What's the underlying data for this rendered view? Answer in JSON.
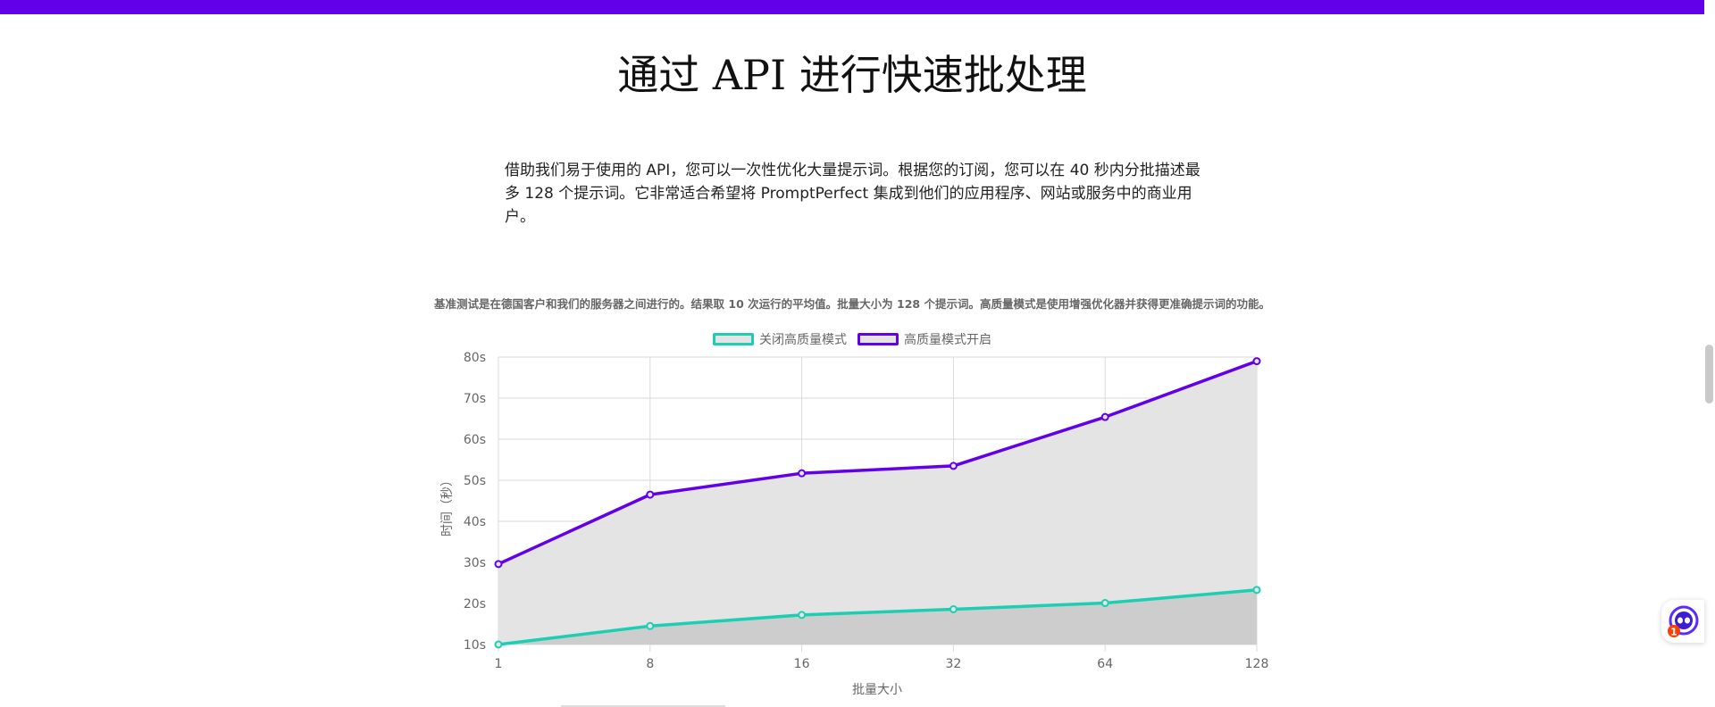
{
  "page": {
    "title": "通过 API 进行快速批处理",
    "intro": "借助我们易于使用的 API，您可以一次性优化大量提示词。根据您的订阅，您可以在 40 秒内分批描述最多 128 个提示词。它非常适合希望将 PromptPerfect 集成到他们的应用程序、网站或服务中的商业用户。",
    "caption": "基准测试是在德国客户和我们的服务器之间进行的。结果取 10 次运行的平均值。批量大小为 128 个提示词。高质量模式是使用增强优化器并获得更准确提示词的功能。"
  },
  "colors": {
    "accent": "#6200ea",
    "teal": "#1ccfb3",
    "purple": "#6200ea",
    "fill_upper": "#e4e4e4",
    "fill_lower": "#cdcdcd",
    "grid": "#dadada",
    "tick_text": "#666666"
  },
  "chat_widget": {
    "icon": "chat-robot-icon",
    "badge": "1",
    "badge_color": "#ff3d00"
  },
  "chart_data": {
    "type": "line",
    "title": "",
    "xlabel": "批量大小",
    "ylabel": "时间（秒）",
    "categories": [
      "1",
      "8",
      "16",
      "32",
      "64",
      "128"
    ],
    "ylim": [
      10,
      80
    ],
    "yticks": [
      "10s",
      "20s",
      "30s",
      "40s",
      "50s",
      "60s",
      "70s",
      "80s"
    ],
    "ytick_values": [
      10,
      20,
      30,
      40,
      50,
      60,
      70,
      80
    ],
    "grid": true,
    "legend_position": "top",
    "series": [
      {
        "name": "关闭高质量模式",
        "values": [
          10,
          14.5,
          17.2,
          18.6,
          20.1,
          23.3
        ],
        "color": "#1ccfb3"
      },
      {
        "name": "高质量模式开启",
        "values": [
          29.6,
          46.5,
          51.7,
          53.5,
          65.4,
          79
        ],
        "color": "#6200ea"
      }
    ]
  }
}
